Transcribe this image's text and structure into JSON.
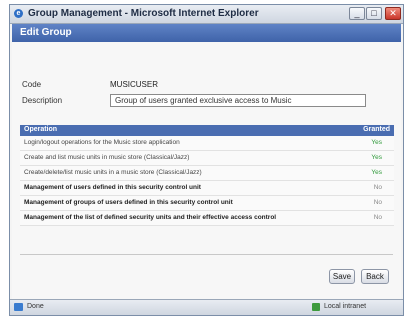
{
  "window": {
    "title": "Group Management - Microsoft Internet Explorer",
    "buttons": {
      "minimize": "_",
      "maximize": "□",
      "close": "✕"
    }
  },
  "header": {
    "title": "Edit Group"
  },
  "form": {
    "code_label": "Code",
    "code_value": "MUSICUSER",
    "description_label": "Description",
    "description_value": "Group of users granted exclusive access to Music"
  },
  "table": {
    "headers": [
      "Operation",
      "Granted"
    ],
    "rows": [
      {
        "operation": "Login/logout operations for the Music store application",
        "granted": "Yes",
        "emphasis": false,
        "status": "granted"
      },
      {
        "operation": "Create and list music units in music store (Classical/Jazz)",
        "granted": "Yes",
        "emphasis": false,
        "status": "granted"
      },
      {
        "operation": "Create/delete/list music units in a music store (Classical/Jazz)",
        "granted": "Yes",
        "emphasis": false,
        "status": "granted"
      },
      {
        "operation": "Management of users defined in this security control unit",
        "granted": "No",
        "emphasis": true,
        "status": "ungranted"
      },
      {
        "operation": "Management of groups of users defined in this security control unit",
        "granted": "No",
        "emphasis": true,
        "status": "ungranted"
      },
      {
        "operation": "Management of the list of defined security units and their effective access control",
        "granted": "No",
        "emphasis": true,
        "status": "ungranted"
      }
    ]
  },
  "actions": {
    "save": "Save",
    "back": "Back"
  },
  "status": {
    "left": "Done",
    "right": "Local intranet"
  },
  "colors": {
    "header": "#4a6db1",
    "granted": "#2f9a3a"
  }
}
